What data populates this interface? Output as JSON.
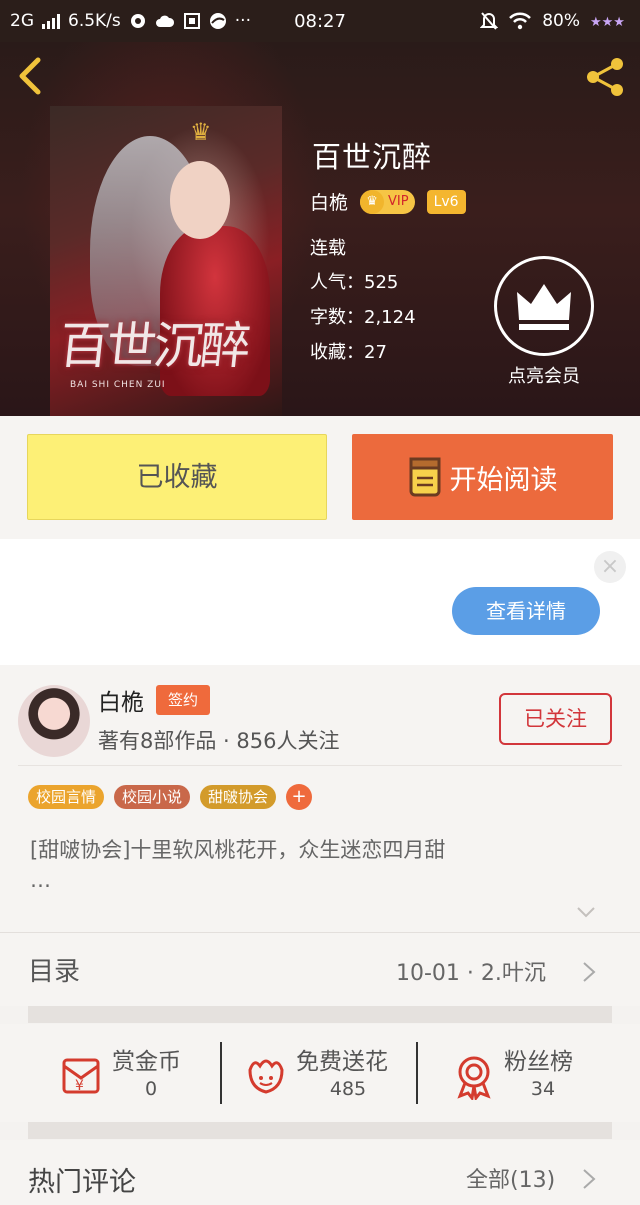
{
  "status_bar": {
    "network": "2G",
    "speed": "6.5K/s",
    "time": "08:27",
    "battery": "80%"
  },
  "book": {
    "title": "百世沉醉",
    "cover_title": "百世沉醉",
    "cover_subtitle": "BAI SHI CHEN ZUI",
    "author": "白桅",
    "vip_label": "VIP",
    "level_label": "Lv6",
    "status": "连载",
    "popularity": "人气：525",
    "word_count": "字数：2,124",
    "favorites": "收藏：27"
  },
  "member": {
    "label": "点亮会员"
  },
  "actions": {
    "collected_label": "已收藏",
    "read_label": "开始阅读"
  },
  "ad": {
    "close_glyph": "×",
    "detail_label": "查看详情"
  },
  "author_card": {
    "name": "白桅",
    "sign_tag": "签约",
    "stats": "著有8部作品 · 856人关注",
    "follow_label": "已关注",
    "tags": [
      "校园言情",
      "校园小说",
      "甜啵协会"
    ],
    "tag_add": "+",
    "intro_line1": "[甜啵协会]十里软风桃花开，众生迷恋四月甜",
    "intro_line2": "…"
  },
  "catalog": {
    "title": "目录",
    "latest": "10-01 · 2.叶沉"
  },
  "rewards": [
    {
      "label": "赏金币",
      "count": "0",
      "icon": "red-envelope-icon"
    },
    {
      "label": "免费送花",
      "count": "485",
      "icon": "flower-icon"
    },
    {
      "label": "粉丝榜",
      "count": "34",
      "icon": "medal-icon"
    }
  ],
  "comments": {
    "title": "热门评论",
    "all_label": "全部(13)"
  },
  "colors": {
    "accent_orange": "#ec6a3d",
    "collected_yellow": "#fdf076",
    "vip_gold": "#f4b62f",
    "follow_red": "#d2363b",
    "ad_blue": "#5b9ee6"
  }
}
